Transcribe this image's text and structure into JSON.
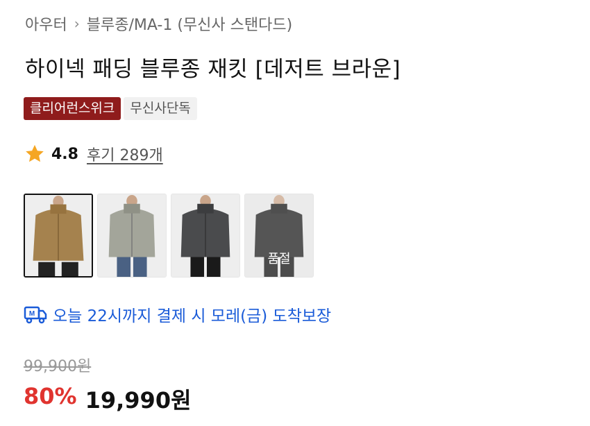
{
  "breadcrumb": {
    "items": [
      "아우터",
      "블루종/MA-1 (무신사 스탠다드)"
    ]
  },
  "product": {
    "title": "하이넥 패딩 블루종 재킷 [데저트 브라운]"
  },
  "badges": [
    {
      "label": "클리어런스위크",
      "color": "#8f1c1c"
    },
    {
      "label": "무신사단독"
    }
  ],
  "rating": {
    "icon": "star-icon",
    "score": "4.8",
    "reviews": "후기 289개"
  },
  "thumbnails": [
    {
      "color_name": "desert-brown",
      "jacket_color": "#a5824e",
      "selected": true
    },
    {
      "color_name": "gray",
      "jacket_color": "#a3a59a",
      "selected": false
    },
    {
      "color_name": "charcoal",
      "jacket_color": "#4a4b4d",
      "selected": false
    },
    {
      "color_name": "black",
      "jacket_color": "#1c1c1c",
      "selected": false,
      "sold_out_label": "품절"
    }
  ],
  "delivery": {
    "icon": "delivery-truck-icon",
    "text": "오늘 22시까지 결제 시 모레(금) 도착보장",
    "color": "#1a5bd8"
  },
  "price": {
    "original": "99,900원",
    "discount": "80%",
    "final": "19,990원",
    "discount_color": "#e0342f"
  }
}
